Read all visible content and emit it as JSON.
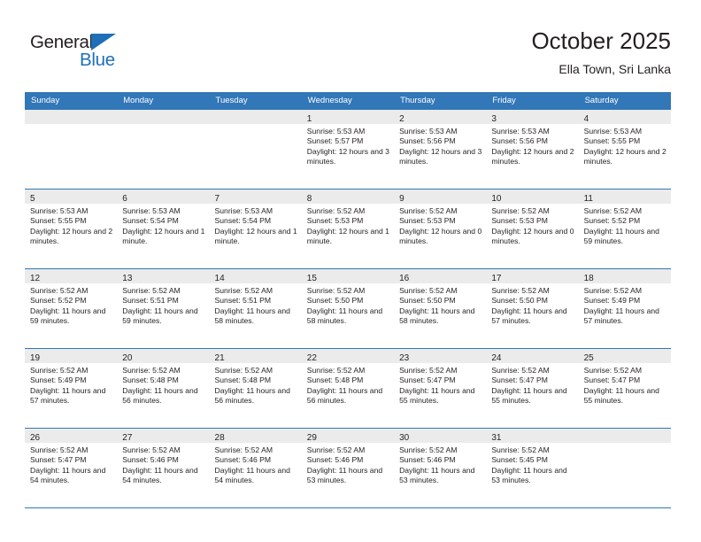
{
  "brand": {
    "name_top": "General",
    "name_bottom": "Blue",
    "triangle_color": "#1e6fb8",
    "text_color": "#231f20"
  },
  "header": {
    "title": "October 2025",
    "subtitle": "Ella Town, Sri Lanka"
  },
  "theme": {
    "header_blue": "#3277b8",
    "daynum_strip": "#ebebeb",
    "text": "#231f20"
  },
  "calendar": {
    "weekday_headers": [
      "Sunday",
      "Monday",
      "Tuesday",
      "Wednesday",
      "Thursday",
      "Friday",
      "Saturday"
    ],
    "weeks": [
      [
        {
          "day": "",
          "sunrise": "",
          "sunset": "",
          "daylight": "",
          "empty": true
        },
        {
          "day": "",
          "sunrise": "",
          "sunset": "",
          "daylight": "",
          "empty": true
        },
        {
          "day": "",
          "sunrise": "",
          "sunset": "",
          "daylight": "",
          "empty": true
        },
        {
          "day": "1",
          "sunrise": "Sunrise: 5:53 AM",
          "sunset": "Sunset: 5:57 PM",
          "daylight": "Daylight: 12 hours and 3 minutes."
        },
        {
          "day": "2",
          "sunrise": "Sunrise: 5:53 AM",
          "sunset": "Sunset: 5:56 PM",
          "daylight": "Daylight: 12 hours and 3 minutes."
        },
        {
          "day": "3",
          "sunrise": "Sunrise: 5:53 AM",
          "sunset": "Sunset: 5:56 PM",
          "daylight": "Daylight: 12 hours and 2 minutes."
        },
        {
          "day": "4",
          "sunrise": "Sunrise: 5:53 AM",
          "sunset": "Sunset: 5:55 PM",
          "daylight": "Daylight: 12 hours and 2 minutes."
        }
      ],
      [
        {
          "day": "5",
          "sunrise": "Sunrise: 5:53 AM",
          "sunset": "Sunset: 5:55 PM",
          "daylight": "Daylight: 12 hours and 2 minutes."
        },
        {
          "day": "6",
          "sunrise": "Sunrise: 5:53 AM",
          "sunset": "Sunset: 5:54 PM",
          "daylight": "Daylight: 12 hours and 1 minute."
        },
        {
          "day": "7",
          "sunrise": "Sunrise: 5:53 AM",
          "sunset": "Sunset: 5:54 PM",
          "daylight": "Daylight: 12 hours and 1 minute."
        },
        {
          "day": "8",
          "sunrise": "Sunrise: 5:52 AM",
          "sunset": "Sunset: 5:53 PM",
          "daylight": "Daylight: 12 hours and 1 minute."
        },
        {
          "day": "9",
          "sunrise": "Sunrise: 5:52 AM",
          "sunset": "Sunset: 5:53 PM",
          "daylight": "Daylight: 12 hours and 0 minutes."
        },
        {
          "day": "10",
          "sunrise": "Sunrise: 5:52 AM",
          "sunset": "Sunset: 5:53 PM",
          "daylight": "Daylight: 12 hours and 0 minutes."
        },
        {
          "day": "11",
          "sunrise": "Sunrise: 5:52 AM",
          "sunset": "Sunset: 5:52 PM",
          "daylight": "Daylight: 11 hours and 59 minutes."
        }
      ],
      [
        {
          "day": "12",
          "sunrise": "Sunrise: 5:52 AM",
          "sunset": "Sunset: 5:52 PM",
          "daylight": "Daylight: 11 hours and 59 minutes."
        },
        {
          "day": "13",
          "sunrise": "Sunrise: 5:52 AM",
          "sunset": "Sunset: 5:51 PM",
          "daylight": "Daylight: 11 hours and 59 minutes."
        },
        {
          "day": "14",
          "sunrise": "Sunrise: 5:52 AM",
          "sunset": "Sunset: 5:51 PM",
          "daylight": "Daylight: 11 hours and 58 minutes."
        },
        {
          "day": "15",
          "sunrise": "Sunrise: 5:52 AM",
          "sunset": "Sunset: 5:50 PM",
          "daylight": "Daylight: 11 hours and 58 minutes."
        },
        {
          "day": "16",
          "sunrise": "Sunrise: 5:52 AM",
          "sunset": "Sunset: 5:50 PM",
          "daylight": "Daylight: 11 hours and 58 minutes."
        },
        {
          "day": "17",
          "sunrise": "Sunrise: 5:52 AM",
          "sunset": "Sunset: 5:50 PM",
          "daylight": "Daylight: 11 hours and 57 minutes."
        },
        {
          "day": "18",
          "sunrise": "Sunrise: 5:52 AM",
          "sunset": "Sunset: 5:49 PM",
          "daylight": "Daylight: 11 hours and 57 minutes."
        }
      ],
      [
        {
          "day": "19",
          "sunrise": "Sunrise: 5:52 AM",
          "sunset": "Sunset: 5:49 PM",
          "daylight": "Daylight: 11 hours and 57 minutes."
        },
        {
          "day": "20",
          "sunrise": "Sunrise: 5:52 AM",
          "sunset": "Sunset: 5:48 PM",
          "daylight": "Daylight: 11 hours and 56 minutes."
        },
        {
          "day": "21",
          "sunrise": "Sunrise: 5:52 AM",
          "sunset": "Sunset: 5:48 PM",
          "daylight": "Daylight: 11 hours and 56 minutes."
        },
        {
          "day": "22",
          "sunrise": "Sunrise: 5:52 AM",
          "sunset": "Sunset: 5:48 PM",
          "daylight": "Daylight: 11 hours and 56 minutes."
        },
        {
          "day": "23",
          "sunrise": "Sunrise: 5:52 AM",
          "sunset": "Sunset: 5:47 PM",
          "daylight": "Daylight: 11 hours and 55 minutes."
        },
        {
          "day": "24",
          "sunrise": "Sunrise: 5:52 AM",
          "sunset": "Sunset: 5:47 PM",
          "daylight": "Daylight: 11 hours and 55 minutes."
        },
        {
          "day": "25",
          "sunrise": "Sunrise: 5:52 AM",
          "sunset": "Sunset: 5:47 PM",
          "daylight": "Daylight: 11 hours and 55 minutes."
        }
      ],
      [
        {
          "day": "26",
          "sunrise": "Sunrise: 5:52 AM",
          "sunset": "Sunset: 5:47 PM",
          "daylight": "Daylight: 11 hours and 54 minutes."
        },
        {
          "day": "27",
          "sunrise": "Sunrise: 5:52 AM",
          "sunset": "Sunset: 5:46 PM",
          "daylight": "Daylight: 11 hours and 54 minutes."
        },
        {
          "day": "28",
          "sunrise": "Sunrise: 5:52 AM",
          "sunset": "Sunset: 5:46 PM",
          "daylight": "Daylight: 11 hours and 54 minutes."
        },
        {
          "day": "29",
          "sunrise": "Sunrise: 5:52 AM",
          "sunset": "Sunset: 5:46 PM",
          "daylight": "Daylight: 11 hours and 53 minutes."
        },
        {
          "day": "30",
          "sunrise": "Sunrise: 5:52 AM",
          "sunset": "Sunset: 5:46 PM",
          "daylight": "Daylight: 11 hours and 53 minutes."
        },
        {
          "day": "31",
          "sunrise": "Sunrise: 5:52 AM",
          "sunset": "Sunset: 5:45 PM",
          "daylight": "Daylight: 11 hours and 53 minutes."
        },
        {
          "day": "",
          "sunrise": "",
          "sunset": "",
          "daylight": "",
          "empty": true
        }
      ]
    ]
  }
}
